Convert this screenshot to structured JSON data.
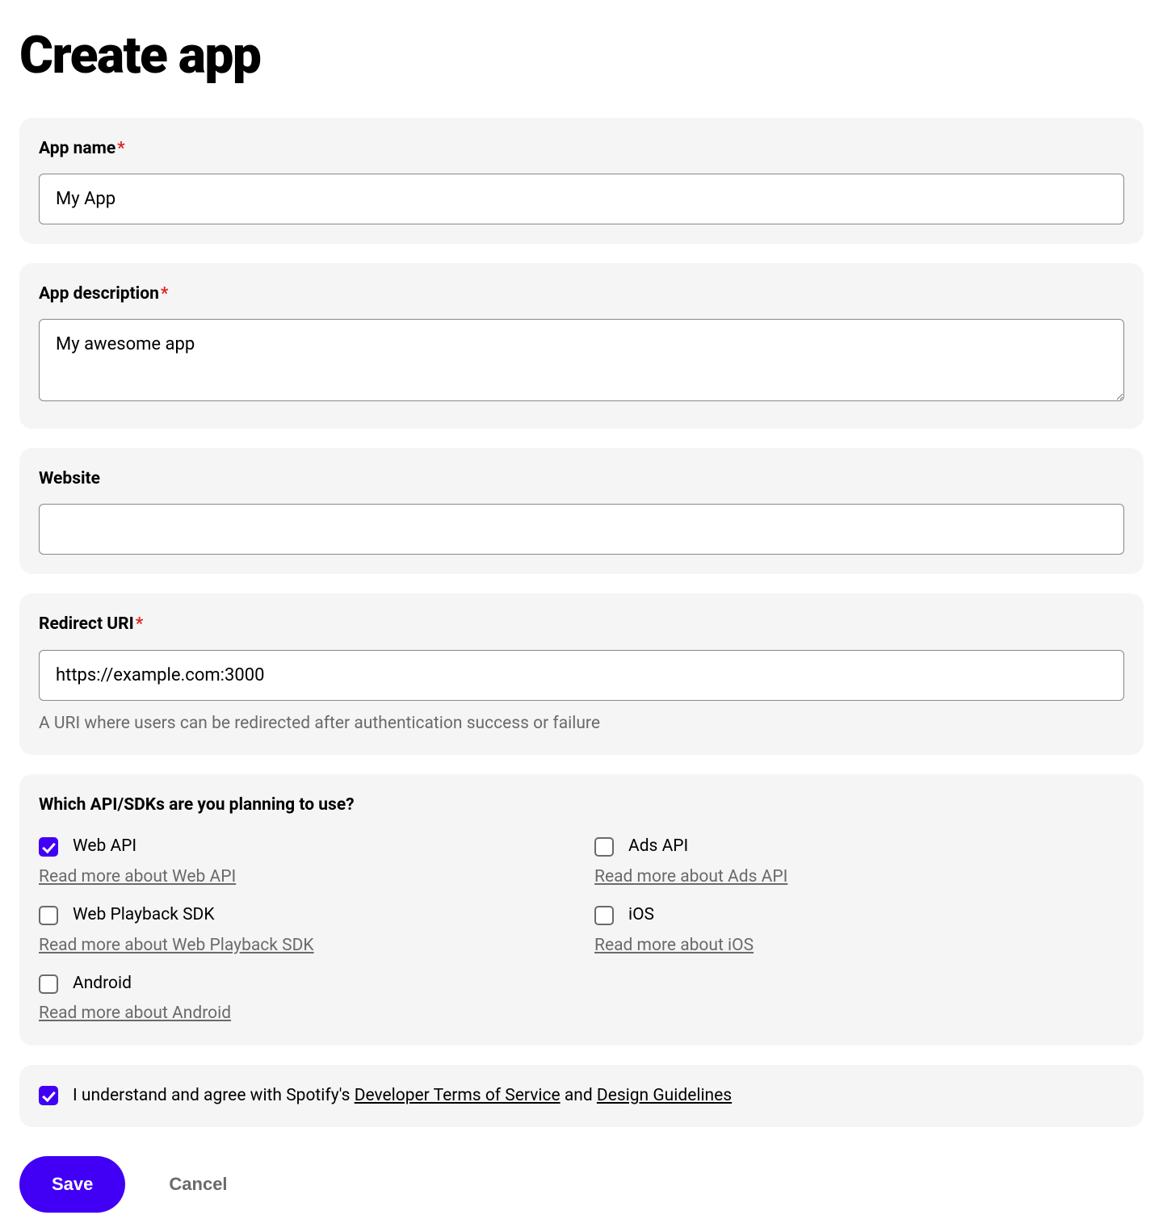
{
  "page": {
    "title": "Create app"
  },
  "fields": {
    "app_name": {
      "label": "App name",
      "required": true,
      "value": "My App"
    },
    "app_description": {
      "label": "App description",
      "required": true,
      "value": "My awesome app"
    },
    "website": {
      "label": "Website",
      "required": false,
      "value": ""
    },
    "redirect_uri": {
      "label": "Redirect URI",
      "required": true,
      "value": "https://example.com:3000",
      "help": "A URI where users can be redirected after authentication success or failure"
    }
  },
  "sdk": {
    "question": "Which API/SDKs are you planning to use?",
    "options": [
      {
        "label": "Web API",
        "checked": true,
        "read_more": "Read more about Web API"
      },
      {
        "label": "Ads API",
        "checked": false,
        "read_more": "Read more about Ads API"
      },
      {
        "label": "Web Playback SDK",
        "checked": false,
        "read_more": "Read more about Web Playback SDK"
      },
      {
        "label": "iOS",
        "checked": false,
        "read_more": "Read more about iOS"
      },
      {
        "label": "Android",
        "checked": false,
        "read_more": "Read more about Android"
      }
    ]
  },
  "tos": {
    "checked": true,
    "prefix": "I understand and agree with Spotify's ",
    "link1": "Developer Terms of Service",
    "connector": " and ",
    "link2": "Design Guidelines"
  },
  "actions": {
    "save": "Save",
    "cancel": "Cancel"
  },
  "required_marker": "*"
}
